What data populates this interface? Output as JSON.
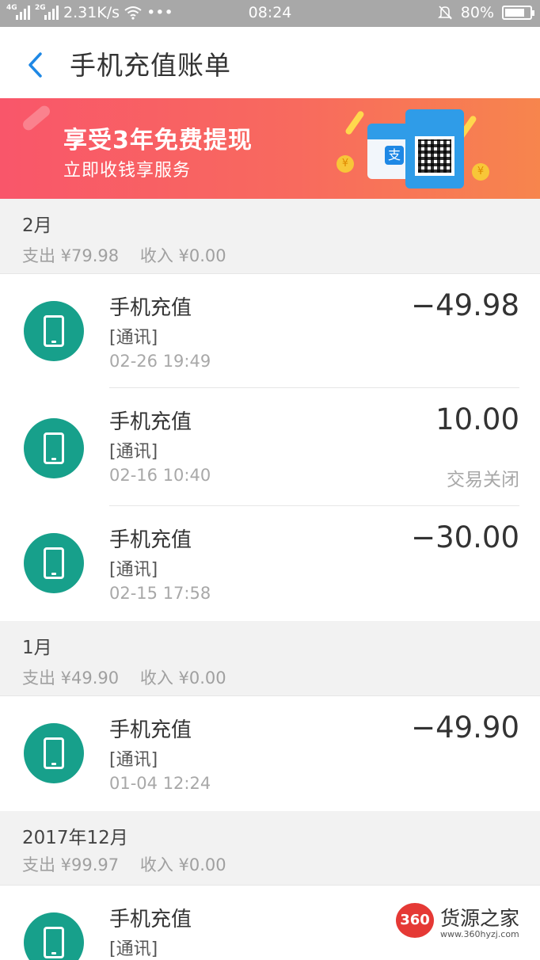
{
  "status_bar": {
    "net1": "4G",
    "net2": "2G",
    "speed": "2.31K/s",
    "more": "•••",
    "time": "08:24",
    "battery": "80%",
    "battery_level": 0.8
  },
  "header": {
    "title": "手机充值账单"
  },
  "banner": {
    "title": "享受3年免费提现",
    "subtitle": "立即收钱享服务"
  },
  "sections": [
    {
      "month": "2月",
      "summary": "支出 ¥79.98    收入 ¥0.00",
      "items": [
        {
          "name": "手机充值",
          "category": "[通讯]",
          "time": "02-26  19:49",
          "amount": "−49.98",
          "status": ""
        },
        {
          "name": "手机充值",
          "category": "[通讯]",
          "time": "02-16  10:40",
          "amount": "10.00",
          "status": "交易关闭"
        },
        {
          "name": "手机充值",
          "category": "[通讯]",
          "time": "02-15  17:58",
          "amount": "−30.00",
          "status": ""
        }
      ]
    },
    {
      "month": "1月",
      "summary": "支出 ¥49.90    收入 ¥0.00",
      "items": [
        {
          "name": "手机充值",
          "category": "[通讯]",
          "time": "01-04  12:24",
          "amount": "−49.90",
          "status": ""
        }
      ]
    },
    {
      "month": "2017年12月",
      "summary": "支出 ¥99.97    收入 ¥0.00",
      "items": [
        {
          "name": "手机充值",
          "category": "[通讯]",
          "time": "",
          "amount": "",
          "status": ""
        }
      ]
    }
  ],
  "watermark": {
    "badge": "360",
    "text": "货源之家",
    "url": "www.360hyzj.com"
  },
  "colors": {
    "accent": "#1e88e5",
    "icon_bg": "#17a08b",
    "banner_start": "#f9566a",
    "banner_end": "#f7854d"
  }
}
